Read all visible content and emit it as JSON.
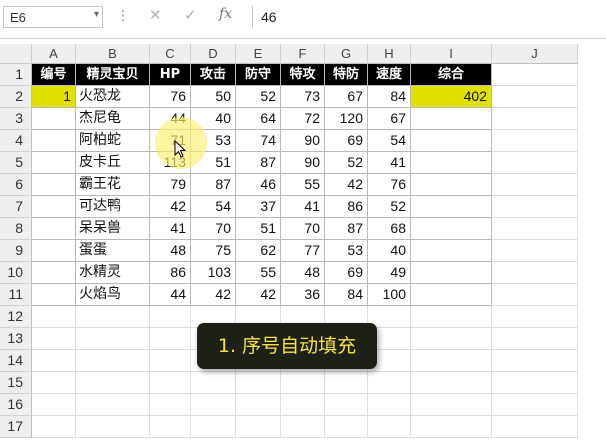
{
  "formula_bar": {
    "name_box": "E6",
    "cancel_icon": "✕",
    "enter_icon": "✓",
    "fx_label": "fx",
    "formula_value": "46"
  },
  "columns": [
    "A",
    "B",
    "C",
    "D",
    "E",
    "F",
    "G",
    "H",
    "I",
    "J"
  ],
  "rows": [
    "1",
    "2",
    "3",
    "4",
    "5",
    "6",
    "7",
    "8",
    "9",
    "10",
    "11",
    "12",
    "13",
    "14",
    "15",
    "16",
    "17"
  ],
  "table": {
    "headers": [
      "编号",
      "精灵宝贝",
      "HP",
      "攻击",
      "防守",
      "特攻",
      "特防",
      "速度",
      "综合"
    ],
    "rows": [
      {
        "id": "1",
        "name": "火恐龙",
        "hp": "76",
        "atk": "50",
        "def": "52",
        "spatk": "73",
        "spdef": "67",
        "spd": "84",
        "total": "402"
      },
      {
        "id": "",
        "name": "杰尼龟",
        "hp": "44",
        "atk": "40",
        "def": "64",
        "spatk": "72",
        "spdef": "120",
        "spd": "67",
        "total": ""
      },
      {
        "id": "",
        "name": "阿柏蛇",
        "hp": "71",
        "atk": "53",
        "def": "74",
        "spatk": "90",
        "spdef": "69",
        "spd": "54",
        "total": ""
      },
      {
        "id": "",
        "name": "皮卡丘",
        "hp": "113",
        "atk": "51",
        "def": "87",
        "spatk": "90",
        "spdef": "52",
        "spd": "41",
        "total": ""
      },
      {
        "id": "",
        "name": "霸王花",
        "hp": "79",
        "atk": "87",
        "def": "46",
        "spatk": "55",
        "spdef": "42",
        "spd": "76",
        "total": ""
      },
      {
        "id": "",
        "name": "可达鸭",
        "hp": "42",
        "atk": "54",
        "def": "37",
        "spatk": "41",
        "spdef": "86",
        "spd": "52",
        "total": ""
      },
      {
        "id": "",
        "name": "呆呆兽",
        "hp": "41",
        "atk": "70",
        "def": "51",
        "spatk": "70",
        "spdef": "87",
        "spd": "68",
        "total": ""
      },
      {
        "id": "",
        "name": "蛋蛋",
        "hp": "48",
        "atk": "75",
        "def": "62",
        "spatk": "77",
        "spdef": "53",
        "spd": "40",
        "total": ""
      },
      {
        "id": "",
        "name": "水精灵",
        "hp": "86",
        "atk": "103",
        "def": "55",
        "spatk": "48",
        "spdef": "69",
        "spd": "49",
        "total": ""
      },
      {
        "id": "",
        "name": "火焰鸟",
        "hp": "44",
        "atk": "42",
        "def": "42",
        "spatk": "36",
        "spdef": "84",
        "spd": "100",
        "total": ""
      }
    ]
  },
  "callout": {
    "text": "1. 序号自动填充"
  },
  "colors": {
    "header_bg": "#000000",
    "header_fg": "#ffffff",
    "highlight_cell": "#e1e100",
    "callout_bg": "#1e2115",
    "callout_fg": "#f5e24a"
  }
}
